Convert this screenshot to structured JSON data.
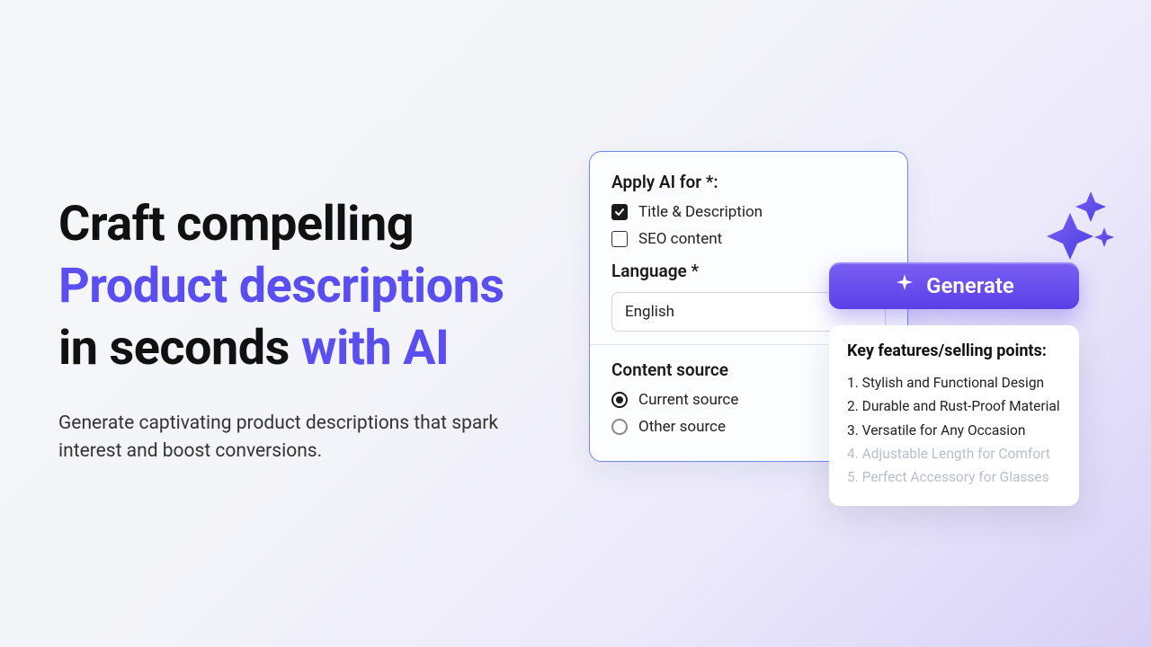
{
  "hero": {
    "line1": "Craft compelling",
    "line2": "Product descriptions",
    "line3a": "in seconds ",
    "line3b": "with AI",
    "sub": "Generate captivating product descriptions that spark interest and boost conversions."
  },
  "form": {
    "apply_label": "Apply AI for *:",
    "options": {
      "title_desc": {
        "label": "Title & Description",
        "checked": true
      },
      "seo": {
        "label": "SEO content",
        "checked": false
      }
    },
    "language_label": "Language *",
    "language_value": "English",
    "source_label": "Content source",
    "radios": {
      "current": {
        "label": "Current source",
        "selected": true
      },
      "other": {
        "label": "Other source",
        "selected": false
      }
    }
  },
  "generate_label": "Generate",
  "features": {
    "title": "Key features/selling points:",
    "items": [
      {
        "text": "Stylish and Functional Design",
        "faded": false
      },
      {
        "text": "Durable and Rust-Proof Material",
        "faded": false
      },
      {
        "text": "Versatile for Any Occasion",
        "faded": false
      },
      {
        "text": "Adjustable Length for Comfort",
        "faded": true
      },
      {
        "text": "Perfect Accessory for Glasses",
        "faded": true
      }
    ]
  },
  "colors": {
    "accent": "#5b4ef0",
    "button_top": "#7a5ff3",
    "button_bottom": "#5a3fe8"
  }
}
